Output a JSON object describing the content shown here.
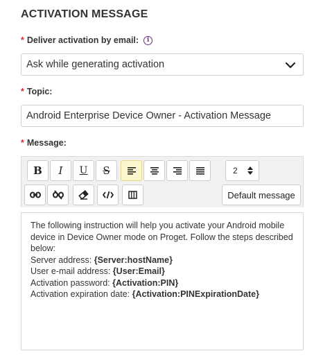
{
  "section": {
    "title": "ACTIVATION MESSAGE"
  },
  "delivery": {
    "required_mark": "*",
    "label": "Deliver activation by email:",
    "info_icon": "info-circle-icon",
    "selected": "Ask while generating activation"
  },
  "topic": {
    "required_mark": "*",
    "label": "Topic:",
    "value": "Android Enterprise Device Owner - Activation Message"
  },
  "message": {
    "required_mark": "*",
    "label": "Message:",
    "toolbar": {
      "bold": "B",
      "italic": "I",
      "underline": "U",
      "strikethrough": "S",
      "font_size": "2",
      "default_message": "Default message"
    },
    "body": {
      "intro": "The following instruction will help you activate your Android mobile device in Device Owner mode on Proget. Follow the steps described below:",
      "lines": [
        {
          "label": "Server address: ",
          "token": "{Server:hostName}"
        },
        {
          "label": "User e-mail address: ",
          "token": "{User:Email}"
        },
        {
          "label": "Activation password: ",
          "token": "{Activation:PIN}"
        },
        {
          "label": "Activation expiration date: ",
          "token": "{Activation:PINExpirationDate}"
        }
      ]
    }
  },
  "colors": {
    "required": "#d0312d",
    "info": "#6d2e86",
    "active_button": "#fdf5cc"
  }
}
